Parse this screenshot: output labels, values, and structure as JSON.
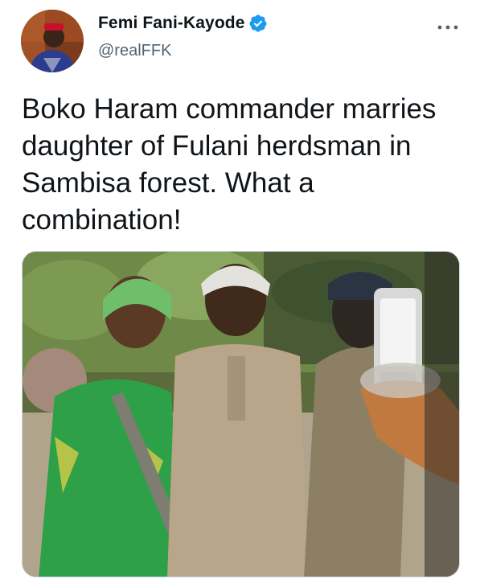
{
  "author": {
    "display_name": "Femi Fani-Kayode",
    "handle": "@realFFK",
    "verified": true
  },
  "tweet": {
    "text": "Boko Haram commander marries\ndaughter of Fulani herdsman in\nSambisa forest. What a\ncombination!"
  },
  "media": {
    "type": "video-still"
  },
  "icons": {
    "verified": "verified-badge-icon",
    "more": "more-options-icon"
  },
  "colors": {
    "verified_blue": "#1d9bf0",
    "text_primary": "#0f1419",
    "text_secondary": "#536471"
  }
}
